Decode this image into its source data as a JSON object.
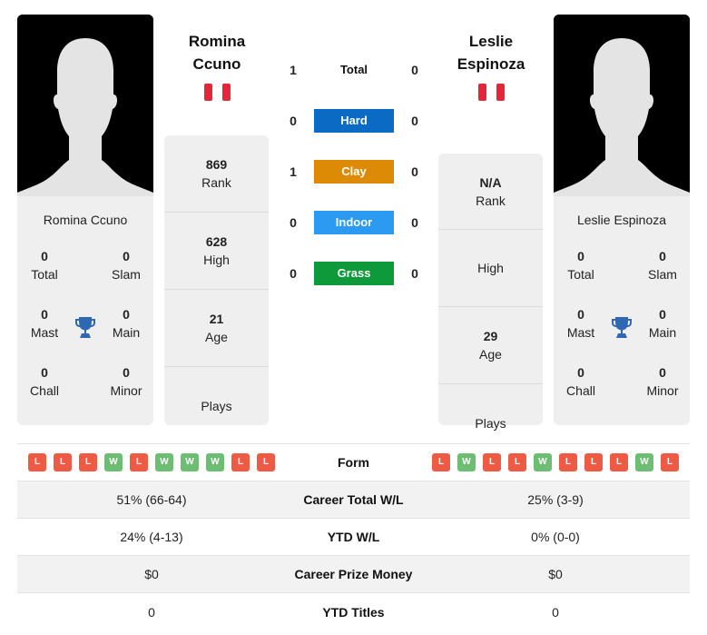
{
  "colors": {
    "hard": "#0b6bc4",
    "clay": "#dd8b06",
    "indoor": "#2c9af0",
    "grass": "#0e9a3b",
    "loss": "#ee5a44",
    "win": "#6dbd73",
    "trophy": "#2f67b3"
  },
  "left_player": {
    "name_line1": "Romina",
    "name_line2": "Ccuno",
    "full_name": "Romina Ccuno",
    "flag": "peru-flag",
    "titles": {
      "total": "0",
      "total_label": "Total",
      "slam": "0",
      "slam_label": "Slam",
      "mast": "0",
      "mast_label": "Mast",
      "main": "0",
      "main_label": "Main",
      "chall": "0",
      "chall_label": "Chall",
      "minor": "0",
      "minor_label": "Minor"
    },
    "info": {
      "rank": "869",
      "rank_label": "Rank",
      "high": "628",
      "high_label": "High",
      "age": "21",
      "age_label": "Age",
      "plays": "",
      "plays_label": "Plays"
    }
  },
  "right_player": {
    "name_line1": "Leslie",
    "name_line2": "Espinoza",
    "full_name": "Leslie Espinoza",
    "flag": "peru-flag",
    "titles": {
      "total": "0",
      "total_label": "Total",
      "slam": "0",
      "slam_label": "Slam",
      "mast": "0",
      "mast_label": "Mast",
      "main": "0",
      "main_label": "Main",
      "chall": "0",
      "chall_label": "Chall",
      "minor": "0",
      "minor_label": "Minor"
    },
    "info": {
      "rank": "N/A",
      "rank_label": "Rank",
      "high": "",
      "high_label": "High",
      "age": "29",
      "age_label": "Age",
      "plays": "",
      "plays_label": "Plays"
    }
  },
  "h2h": [
    {
      "label": "Total",
      "left": "1",
      "right": "0",
      "type": "total"
    },
    {
      "label": "Hard",
      "left": "0",
      "right": "0",
      "type": "hard"
    },
    {
      "label": "Clay",
      "left": "1",
      "right": "0",
      "type": "clay"
    },
    {
      "label": "Indoor",
      "left": "0",
      "right": "0",
      "type": "indoor"
    },
    {
      "label": "Grass",
      "left": "0",
      "right": "0",
      "type": "grass"
    }
  ],
  "comparison": {
    "form_label": "Form",
    "left_form": [
      "L",
      "L",
      "L",
      "W",
      "L",
      "W",
      "W",
      "W",
      "L",
      "L"
    ],
    "right_form": [
      "L",
      "W",
      "L",
      "L",
      "W",
      "L",
      "L",
      "L",
      "W",
      "L"
    ],
    "rows": [
      {
        "label": "Career Total W/L",
        "left": "51% (66-64)",
        "right": "25% (3-9)"
      },
      {
        "label": "YTD W/L",
        "left": "24% (4-13)",
        "right": "0% (0-0)"
      },
      {
        "label": "Career Prize Money",
        "left": "$0",
        "right": "$0"
      },
      {
        "label": "YTD Titles",
        "left": "0",
        "right": "0"
      }
    ]
  }
}
